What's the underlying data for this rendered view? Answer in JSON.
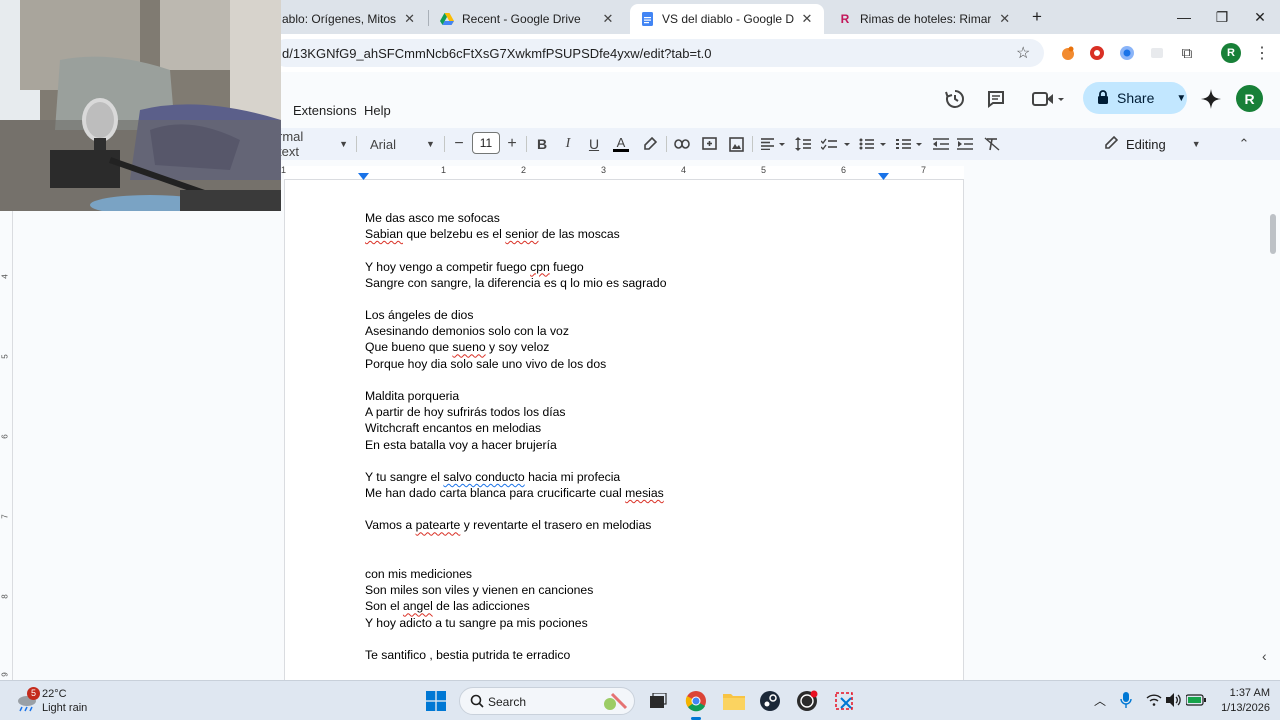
{
  "browser": {
    "tabs": [
      {
        "label": "ablo: Orígenes, Mitos y Cu",
        "icon": "doc-icon",
        "active": false
      },
      {
        "label": "Recent - Google Drive",
        "icon": "google-drive-icon",
        "active": false
      },
      {
        "label": "VS del diablo - Google Docs",
        "icon": "google-docs-icon",
        "active": true
      },
      {
        "label": "Rimas de hoteles: Rimar.io",
        "icon": "rimar-icon",
        "active": false
      }
    ],
    "favicon_r": "R",
    "tab_close": "✕",
    "new_tab": "+",
    "url": "d/13KGNfG9_ahSFCmmNcb6cFtXsG7XwkmfPSUPSDfe4yxw/edit?tab=t.0",
    "profile_initial": "R"
  },
  "docs": {
    "menu": [
      "Extensions",
      "Help"
    ],
    "share_label": "Share",
    "avatar_initial": "R",
    "toolbar": {
      "style": "rmal text",
      "font": "Arial",
      "font_size": "11",
      "mode": "Editing"
    },
    "ruler_numbers": [
      "1",
      "1",
      "2",
      "3",
      "4",
      "5",
      "6",
      "7"
    ],
    "vruler_numbers": [
      "4",
      "5",
      "6",
      "7",
      "8",
      "9"
    ],
    "lines": [
      {
        "text": "Me das asco me sofocas"
      },
      {
        "parts": [
          {
            "t": "Sabian",
            "u": "sq"
          },
          {
            "t": " que belzebu es el "
          },
          {
            "t": "senior",
            "u": "sq"
          },
          {
            "t": " de las moscas"
          }
        ]
      },
      {
        "text": ""
      },
      {
        "parts": [
          {
            "t": "Y hoy vengo a competir fuego "
          },
          {
            "t": "cpn",
            "u": "sq"
          },
          {
            "t": " fuego"
          }
        ]
      },
      {
        "text": "Sangre con sangre, la diferencia es q lo mio es sagrado"
      },
      {
        "text": ""
      },
      {
        "text": "Los ángeles de dios"
      },
      {
        "text": "Asesinando demonios solo con la voz"
      },
      {
        "parts": [
          {
            "t": "Que bueno que "
          },
          {
            "t": "sueno",
            "u": "sq"
          },
          {
            "t": " y soy veloz"
          }
        ]
      },
      {
        "text": "Porque hoy dia solo sale uno vivo de los dos"
      },
      {
        "text": ""
      },
      {
        "text": "Maldita porqueria"
      },
      {
        "text": "A partir de hoy sufrirás todos los días"
      },
      {
        "text": "Witchcraft encantos en melodias"
      },
      {
        "text": "En esta batalla voy a hacer brujería"
      },
      {
        "text": ""
      },
      {
        "parts": [
          {
            "t": "Y tu sangre el "
          },
          {
            "t": "salvo conducto",
            "u": "gq"
          },
          {
            "t": " hacia mi profecia"
          }
        ]
      },
      {
        "parts": [
          {
            "t": "Me han dado carta blanca para crucificarte cual "
          },
          {
            "t": "mesias",
            "u": "sq"
          }
        ]
      },
      {
        "text": ""
      },
      {
        "parts": [
          {
            "t": "Vamos a "
          },
          {
            "t": "patearte",
            "u": "sq"
          },
          {
            "t": " y reventarte el trasero en melodias"
          }
        ]
      },
      {
        "text": ""
      },
      {
        "text": ""
      },
      {
        "text": "con mis mediciones"
      },
      {
        "text": "Son miles son viles y vienen en canciones"
      },
      {
        "parts": [
          {
            "t": "Son el "
          },
          {
            "t": "angel",
            "u": "sq"
          },
          {
            "t": " de las adicciones"
          }
        ]
      },
      {
        "text": "Y hoy adicto a tu sangre pa mis pociones"
      },
      {
        "text": ""
      },
      {
        "text": "Te santifico , bestia putrida te erradico"
      }
    ]
  },
  "taskbar": {
    "weather_temp": "22°C",
    "weather_desc": "Light rain",
    "weather_badge": "5",
    "search_label": "Search",
    "time": "1:37 AM",
    "date": "1/13/2026"
  },
  "colors": {
    "accent": "#1a73e8",
    "share_bg": "#c2e7ff",
    "spell_error": "#d93025"
  }
}
